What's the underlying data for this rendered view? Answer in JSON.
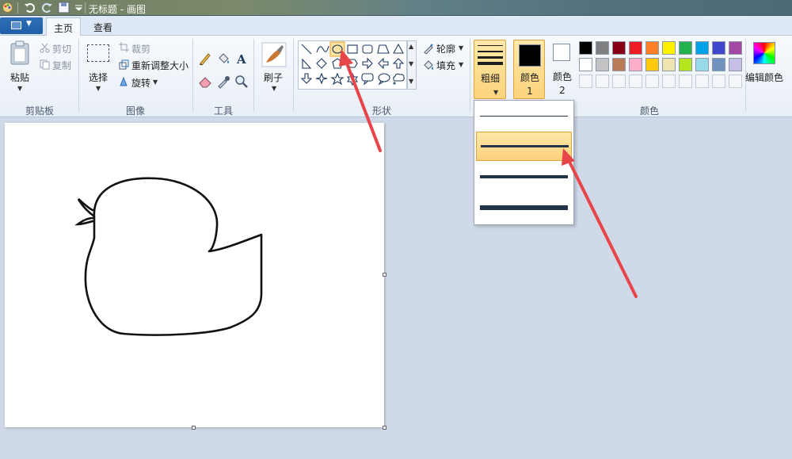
{
  "window": {
    "title": "无标题 - 画图"
  },
  "tabs": [
    {
      "label": "主页",
      "active": true
    },
    {
      "label": "查看",
      "active": false
    }
  ],
  "clipboard": {
    "paste_label": "粘贴",
    "cut_label": "剪切",
    "copy_label": "复制",
    "group_label": "剪贴板"
  },
  "image": {
    "select_label": "选择",
    "crop_label": "裁剪",
    "resize_label": "重新调整大小",
    "rotate_label": "旋转",
    "group_label": "图像"
  },
  "tools": {
    "group_label": "工具",
    "text_glyph": "A"
  },
  "brushes": {
    "label": "刷子"
  },
  "shapes": {
    "group_label": "形状",
    "outline_label": "轮廓",
    "fill_label": "填充",
    "selected_shape": "ellipse-icon",
    "items": [
      "line",
      "curve",
      "ellipse",
      "rectangle",
      "rounded-rectangle",
      "polygon",
      "triangle",
      "right-triangle",
      "diamond",
      "pentagon",
      "hexagon",
      "right-arrow",
      "left-arrow",
      "up-arrow",
      "down-arrow",
      "four-point-star",
      "five-point-star",
      "six-point-star",
      "rounded-callout",
      "oval-callout",
      "cloud-callout"
    ]
  },
  "size": {
    "label": "粗细",
    "selected_index": 1,
    "options_count": 4
  },
  "colors": {
    "color1_label": "颜色 1",
    "color2_label": "颜色 2",
    "group_label": "颜色",
    "edit_label": "编辑颜色",
    "color1": "#000000",
    "color2": "#ffffff",
    "palette_row1": [
      "#000000",
      "#7f7f7f",
      "#880015",
      "#ed1c24",
      "#ff7f27",
      "#fff200",
      "#22b14c",
      "#00a2e8",
      "#3f48cc",
      "#a349a4"
    ],
    "palette_row2": [
      "#ffffff",
      "#c3c3c3",
      "#b97a57",
      "#ffaec9",
      "#ffc90e",
      "#efe4b0",
      "#b5e61d",
      "#99d9ea",
      "#7092be",
      "#c8bfe7"
    ]
  },
  "accent": {
    "highlight": "#fcd37d",
    "arrow": "#e8454a"
  }
}
